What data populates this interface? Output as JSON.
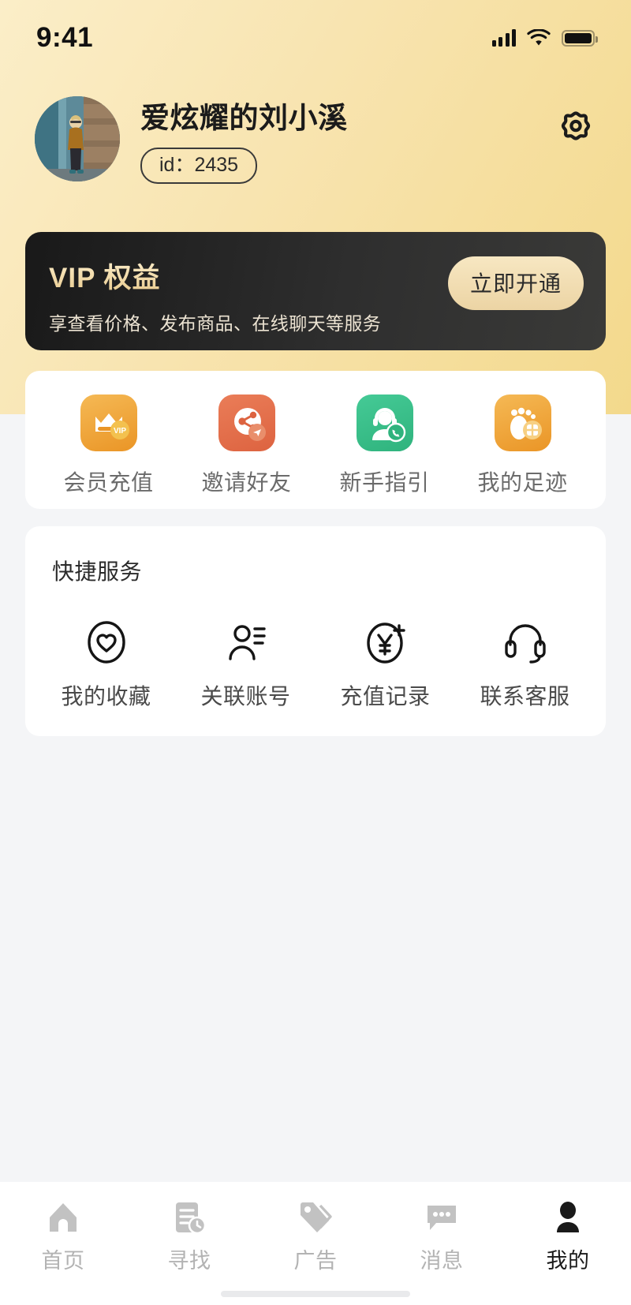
{
  "status_bar": {
    "time": "9:41",
    "signal_icon": "cellular-bars-icon",
    "wifi_icon": "wifi-icon",
    "battery_icon": "battery-full-icon"
  },
  "profile": {
    "avatar_icon": "user-avatar-photo",
    "username": "爱炫耀的刘小溪",
    "id_label": "id：2435",
    "settings_icon": "gear-icon"
  },
  "vip_banner": {
    "title": "VIP 权益",
    "subtitle": "享查看价格、发布商品、在线聊天等服务",
    "cta_label": "立即开通",
    "bg_color": "#222222",
    "gold_color": "#eed79f",
    "cta_bg": "#f0dcb2"
  },
  "entries": {
    "items": [
      {
        "label": "会员充值",
        "icon": "crown-vip-icon",
        "color": "#f0a93c"
      },
      {
        "label": "邀请好友",
        "icon": "share-invite-icon",
        "color": "#e4724c"
      },
      {
        "label": "新手指引",
        "icon": "support-agent-icon",
        "color": "#3dbf8b"
      },
      {
        "label": "我的足迹",
        "icon": "footprint-icon",
        "color": "#f0a93c"
      }
    ]
  },
  "services": {
    "title": "快捷服务",
    "items": [
      {
        "label": "我的收藏",
        "icon": "heart-circle-icon"
      },
      {
        "label": "关联账号",
        "icon": "linked-account-icon"
      },
      {
        "label": "充值记录",
        "icon": "yen-plus-circle-icon"
      },
      {
        "label": "联系客服",
        "icon": "headset-icon"
      }
    ]
  },
  "tabbar": {
    "items": [
      {
        "label": "首页",
        "icon": "home-icon",
        "active": false
      },
      {
        "label": "寻找",
        "icon": "document-clock-icon",
        "active": false
      },
      {
        "label": "广告",
        "icon": "price-tag-icon",
        "active": false
      },
      {
        "label": "消息",
        "icon": "chat-bubble-icon",
        "active": false
      },
      {
        "label": "我的",
        "icon": "person-icon",
        "active": true
      }
    ],
    "active_color": "#1a1a1a",
    "inactive_color": "#b3b3b3"
  }
}
